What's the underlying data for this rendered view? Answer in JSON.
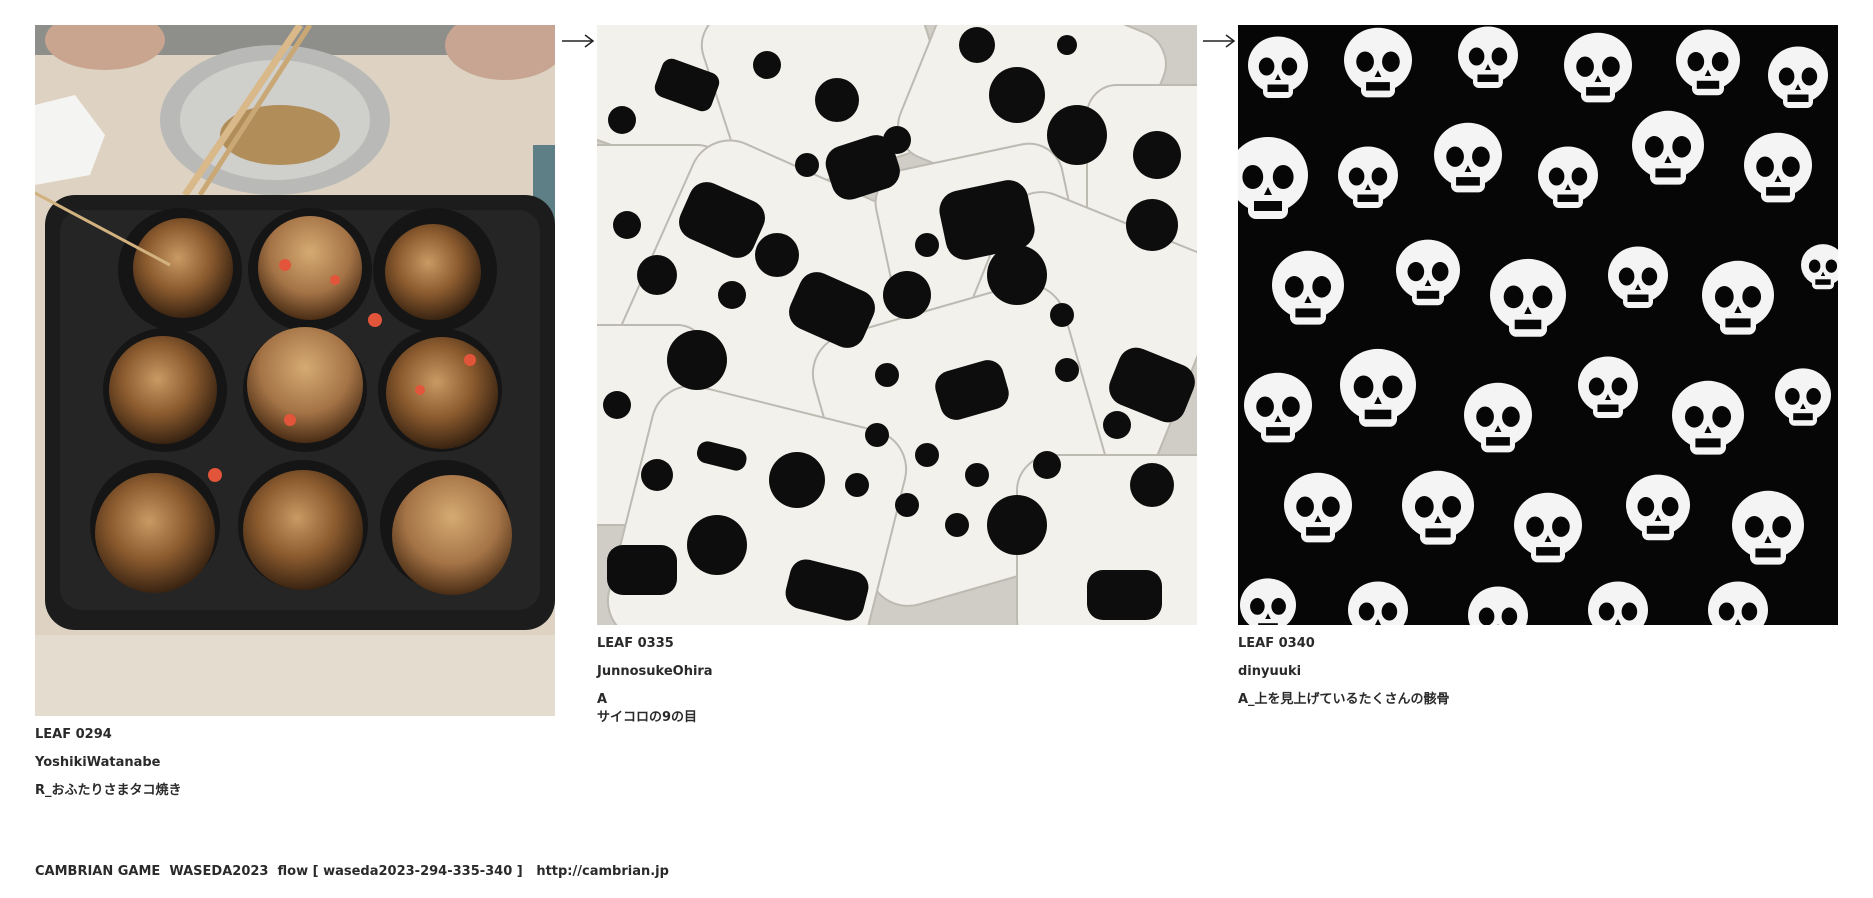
{
  "leaves": [
    {
      "id_label": "LEAF 0294",
      "author": "YoshikiWatanabe",
      "caption": "R_おふたりさまタコ焼き",
      "image_subject": "takoyaki-pan-photo"
    },
    {
      "id_label": "LEAF 0335",
      "author": "JunnosukeOhira",
      "caption": "A\nサイコロの9の目",
      "image_subject": "white-dice-with-black-pips"
    },
    {
      "id_label": "LEAF 0340",
      "author": "dinyuuki",
      "caption": "A_上を見上げているたくさんの骸骨",
      "image_subject": "many-skulls-looking-up"
    }
  ],
  "arrows": [
    "arrow-right-icon",
    "arrow-right-icon"
  ],
  "footer": {
    "text": "CAMBRIAN GAME  WASEDA2023  flow [ waseda2023-294-335-340 ]   http://cambrian.jp"
  },
  "colors": {
    "background": "#ffffff",
    "text": "#2a2a2a",
    "pan": "#1c1c1c",
    "skull_bg": "#060606",
    "dice_white": "#f2f1ec"
  }
}
